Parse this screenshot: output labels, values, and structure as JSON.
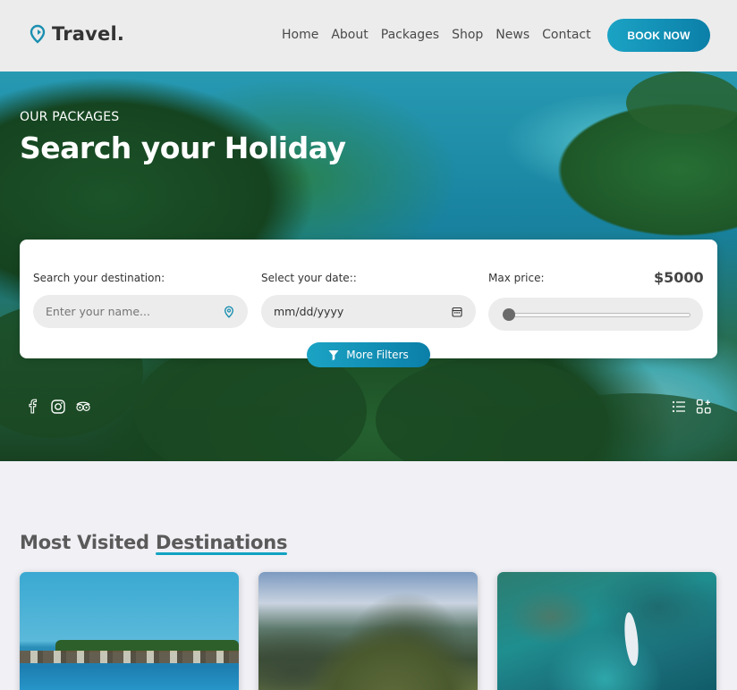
{
  "header": {
    "logo": "Travel.",
    "nav": [
      "Home",
      "About",
      "Packages",
      "Shop",
      "News",
      "Contact"
    ],
    "cta": "BOOK NOW"
  },
  "hero": {
    "eyebrow": "OUR PACKAGES",
    "title_prefix": "Search your",
    "title_highlight": "Holiday"
  },
  "search": {
    "destination_label": "Search your destination:",
    "destination_placeholder": "Enter your name...",
    "date_label": "Select your date::",
    "date_value": "mm/dd/yyyy",
    "price_label": "Max price:",
    "price_value": "$5000",
    "price_slider_fraction": 0,
    "filters_button": "More Filters"
  },
  "social": [
    "facebook-icon",
    "instagram-icon",
    "tripadvisor-icon"
  ],
  "view_toggle": [
    "list-view-icon",
    "grid-view-icon"
  ],
  "destinations": {
    "title_prefix": "Most Visited",
    "title_highlight": "Destinations",
    "cards": [
      "overwater-bungalows",
      "machu-picchu",
      "kayak-reef"
    ]
  },
  "colors": {
    "accent": "#13a3c2",
    "button_gradient_start": "#1ba3c4",
    "button_gradient_end": "#0b7fa8"
  }
}
